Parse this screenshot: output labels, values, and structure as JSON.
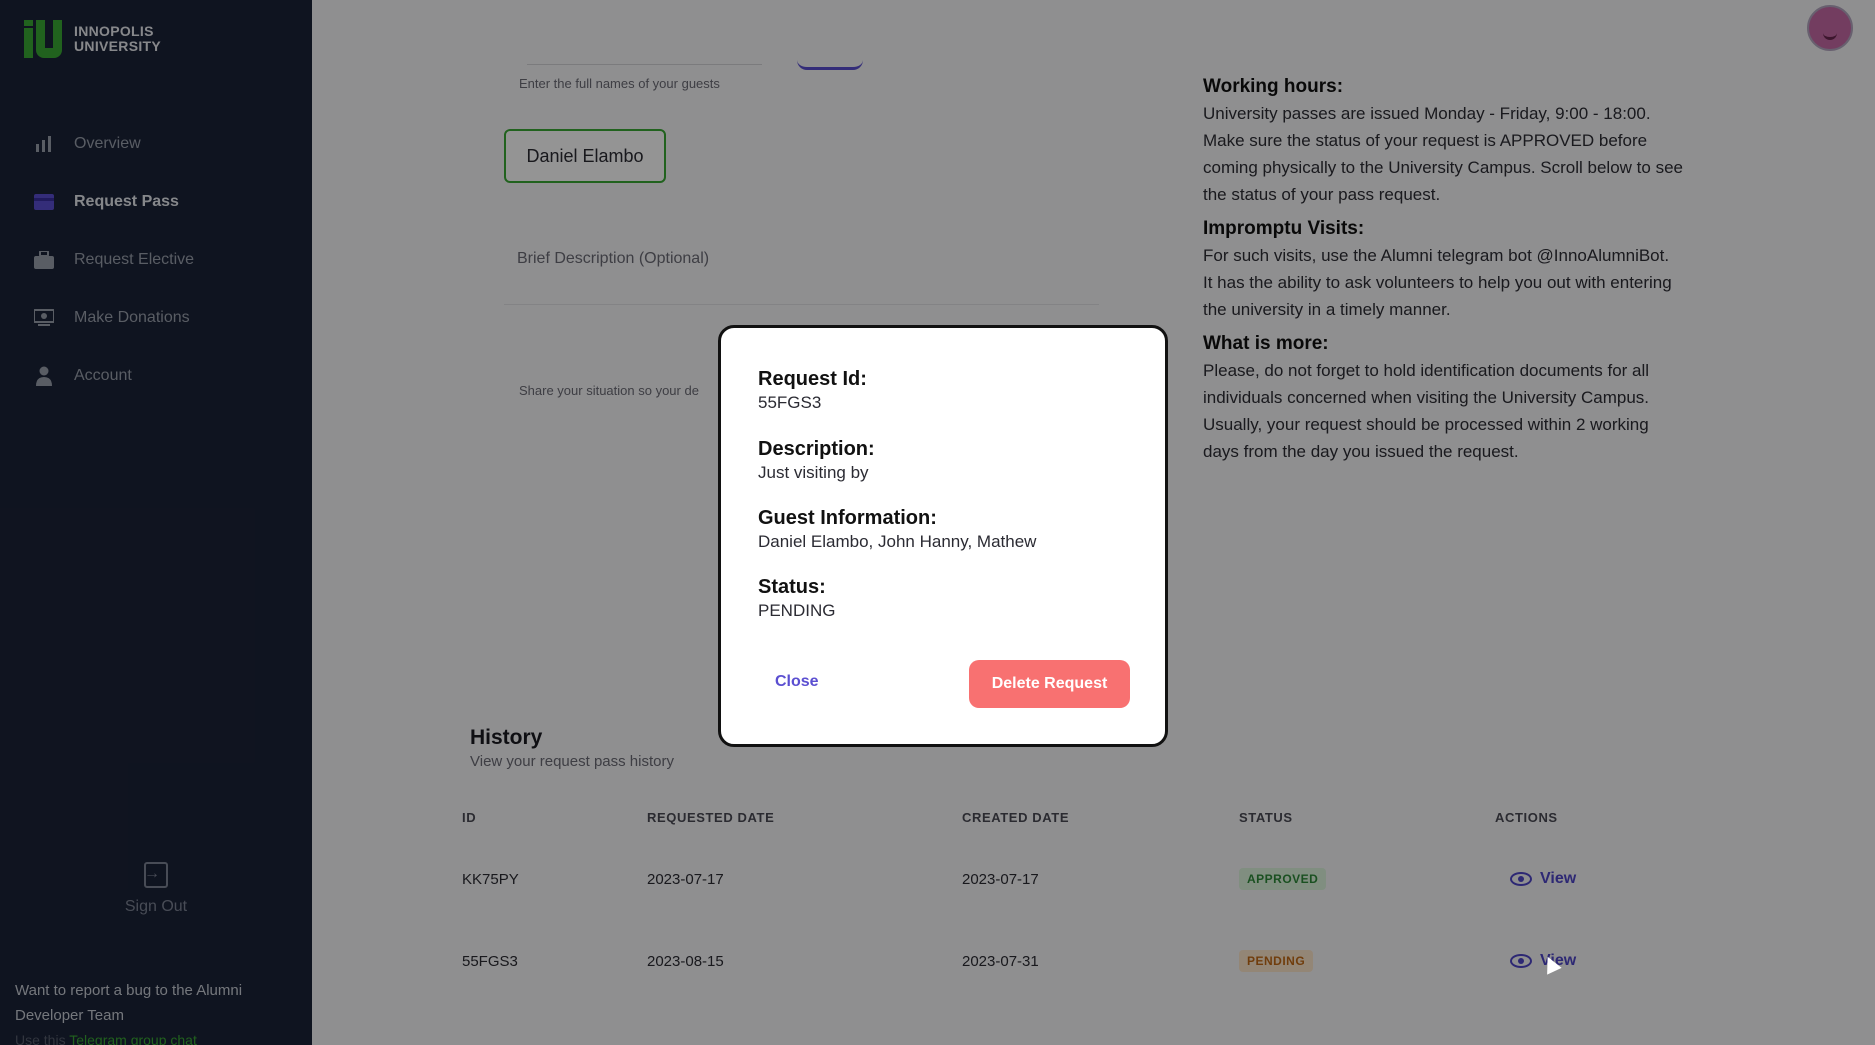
{
  "brand": {
    "line1": "INNOPOLIS",
    "line2": "UNIVERSITY",
    "color": "#3aa935"
  },
  "sidebar": {
    "items": [
      {
        "label": "Overview",
        "icon": "bar-chart-icon",
        "active": false
      },
      {
        "label": "Request Pass",
        "icon": "card-icon",
        "active": true
      },
      {
        "label": "Request Elective",
        "icon": "briefcase-icon",
        "active": false
      },
      {
        "label": "Make Donations",
        "icon": "money-icon",
        "active": false
      },
      {
        "label": "Account",
        "icon": "user-icon",
        "active": false
      }
    ],
    "signout_label": "Sign Out",
    "bug_text": "Want to report a bug to the Alumni Developer Team",
    "bug_hint_prefix": "Use this",
    "bug_hint_link": "Telegram group chat"
  },
  "form": {
    "guest_hint": "Enter the full names of your guests",
    "guest_chip": "Daniel Elambo",
    "description_label": "Brief Description (Optional)",
    "description_hint": "Share your situation so your de"
  },
  "info": {
    "sections": [
      {
        "title": "Working hours:",
        "text": "University passes are issued Monday - Friday, 9:00 - 18:00. Make sure the status of your request is APPROVED before coming physically to the University Campus. Scroll below to see the status of your pass request."
      },
      {
        "title": "Impromptu Visits:",
        "text": "For such visits, use the Alumni telegram bot @InnoAlumniBot. It has the ability to ask volunteers to help you out with entering the university in a timely manner."
      },
      {
        "title": "What is more:",
        "text": "Please, do not forget to hold identification documents for all individuals concerned when visiting the University Campus. Usually, your request should be processed within 2 working days from the day you issued the request."
      }
    ]
  },
  "history": {
    "title": "History",
    "subtitle": "View your request pass history",
    "headers": [
      "ID",
      "REQUESTED DATE",
      "CREATED DATE",
      "STATUS",
      "ACTIONS"
    ],
    "rows": [
      {
        "id": "KK75PY",
        "requested": "2023-07-17",
        "created": "2023-07-17",
        "status": "APPROVED",
        "action": "View"
      },
      {
        "id": "55FGS3",
        "requested": "2023-08-15",
        "created": "2023-07-31",
        "status": "PENDING",
        "action": "View"
      }
    ]
  },
  "modal": {
    "request_id_label": "Request Id:",
    "request_id": "55FGS3",
    "description_label": "Description:",
    "description": "Just visiting by",
    "guest_label": "Guest Information:",
    "guests": "Daniel Elambo, John Hanny, Mathew",
    "status_label": "Status:",
    "status": "PENDING",
    "close_label": "Close",
    "delete_label": "Delete Request"
  },
  "colors": {
    "sidebar_bg": "#1b2337",
    "accent": "#5b4fd1",
    "danger": "#f87171"
  }
}
